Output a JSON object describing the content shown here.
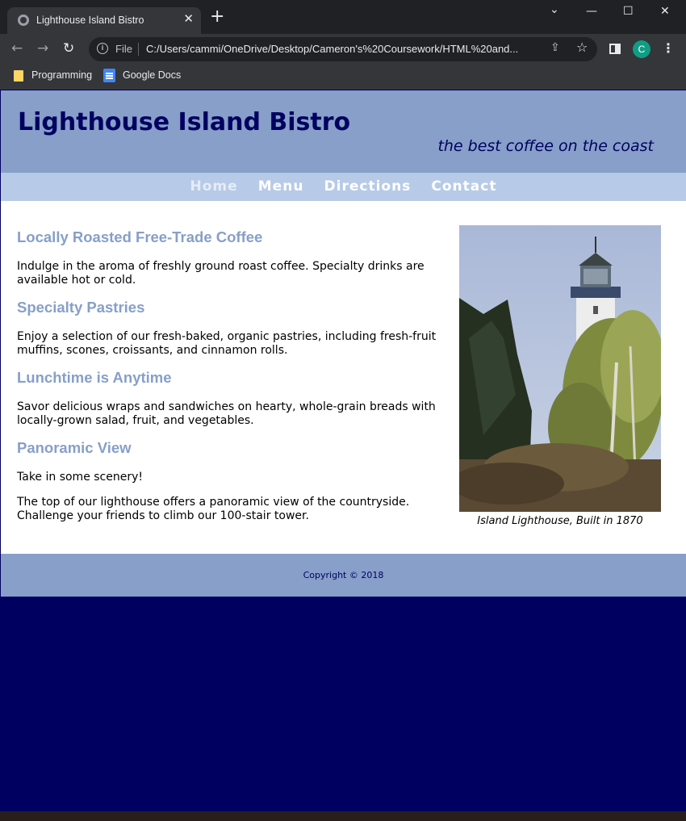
{
  "browser": {
    "tab_title": "Lighthouse Island Bistro",
    "tab_close": "✕",
    "new_tab": "+",
    "window_controls": {
      "dropdown": "⌄",
      "minimize": "—",
      "maximize": "☐",
      "close": "✕"
    },
    "nav": {
      "back": "←",
      "forward": "→",
      "reload": "↻"
    },
    "address_bar": {
      "scheme_label": "File",
      "url": "C:/Users/cammi/OneDrive/Desktop/Cameron's%20Coursework/HTML%20and..."
    },
    "profile_initial": "C",
    "menu": "⋮",
    "bookmarks": [
      {
        "label": "Programming"
      },
      {
        "label": "Google Docs"
      }
    ]
  },
  "site": {
    "title": "Lighthouse Island Bistro",
    "tagline": "the best coffee on the coast",
    "nav": [
      {
        "label": "Home",
        "current": true
      },
      {
        "label": "Menu"
      },
      {
        "label": "Directions"
      },
      {
        "label": "Contact"
      }
    ],
    "sections": [
      {
        "heading": "Locally Roasted Free-Trade Coffee",
        "paragraphs": [
          "Indulge in the aroma of freshly ground roast coffee. Specialty drinks are available hot or cold."
        ]
      },
      {
        "heading": "Specialty Pastries",
        "paragraphs": [
          "Enjoy a selection of our fresh-baked, organic pastries, including fresh-fruit muffins, scones, croissants, and cinnamon rolls."
        ]
      },
      {
        "heading": "Lunchtime is Anytime",
        "paragraphs": [
          "Savor delicious wraps and sandwiches on hearty, whole-grain breads with locally-grown salad, fruit, and vegetables."
        ]
      },
      {
        "heading": "Panoramic View",
        "paragraphs": [
          "Take in some scenery!",
          "The top of our lighthouse offers a panoramic view of the countryside. Challenge your friends to climb our 100-stair tower."
        ]
      }
    ],
    "figure_caption": "Island Lighthouse, Built in 1870",
    "footer": "Copyright © 2018",
    "colors": {
      "dark_navy": "#000060",
      "header_blue": "#879fc9",
      "nav_blue": "#b7cbe8"
    }
  }
}
